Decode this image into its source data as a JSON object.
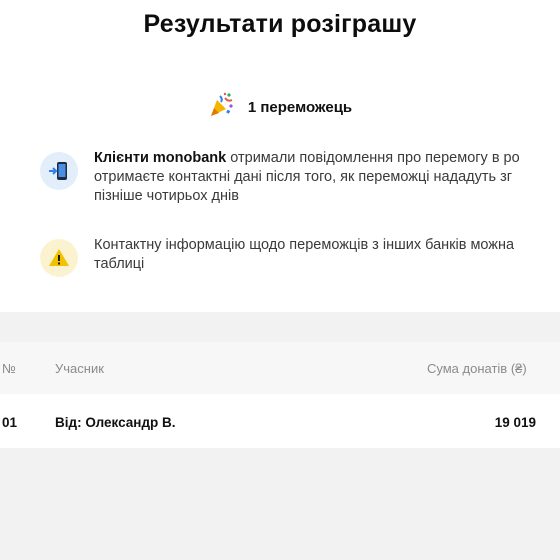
{
  "page": {
    "title": "Результати розіграшу"
  },
  "winners": {
    "icon": "party-popper-icon",
    "count_label": "1 переможець"
  },
  "notices": [
    {
      "icon": "phone-incoming-icon",
      "bold": "Клієнти monobank",
      "line1_rest": " отримали повідомлення про перемогу в ро",
      "line2": "отримаєте контактні дані після того, як переможці нададуть зг",
      "line3": "пізніше чотирьох днів"
    },
    {
      "icon": "warning-icon",
      "line1": "Контактну інформацію щодо переможців з інших банків можна",
      "line2": "таблиці"
    }
  ],
  "table": {
    "columns": {
      "number": "№",
      "participant": "Учасник",
      "donations": "Сума донатів (₴)"
    },
    "rows": [
      {
        "number": "01",
        "participant": "Від: Олександр В.",
        "donations": "19 019"
      }
    ]
  },
  "colors": {
    "info_badge": "#e3eefb",
    "warning_badge": "#fbf3cf",
    "warning_icon": "#f2c200",
    "gray_bg": "#f2f2f2"
  }
}
